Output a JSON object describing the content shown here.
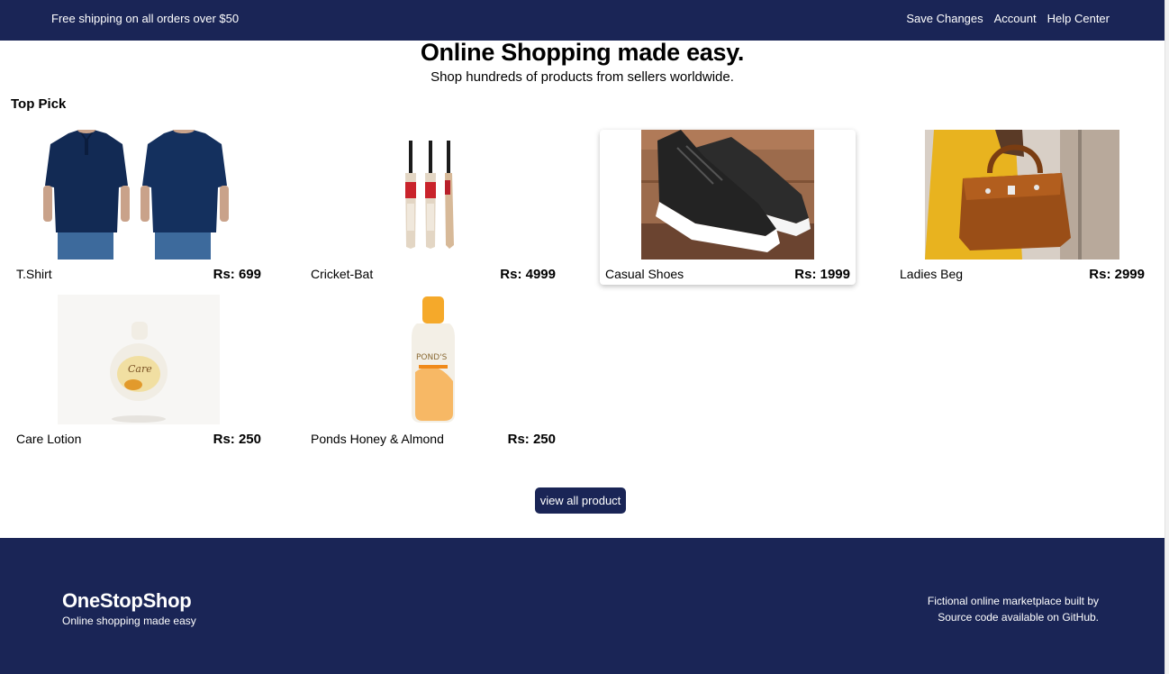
{
  "topbar": {
    "promo": "Free shipping on all orders over $50",
    "links": [
      "Save Changes",
      "Account",
      "Help Center"
    ]
  },
  "hero": {
    "title": "Online Shopping made easy.",
    "subtitle": "Shop hundreds of products from sellers worldwide."
  },
  "section_title": "Top Pick",
  "products": [
    {
      "name": "T.Shirt",
      "price": "Rs: 699"
    },
    {
      "name": "Cricket-Bat",
      "price": "Rs: 4999"
    },
    {
      "name": "Casual Shoes",
      "price": "Rs: 1999"
    },
    {
      "name": "Ladies Beg",
      "price": "Rs: 2999"
    },
    {
      "name": "Care Lotion",
      "price": "Rs: 250"
    },
    {
      "name": "Ponds Honey & Almond",
      "price": "Rs: 250"
    }
  ],
  "view_all_label": "view all product",
  "footer": {
    "brand": "OneStopShop",
    "tagline": "Online shopping made easy",
    "line1": "Fictional online marketplace built by",
    "line2_prefix": "Source code available on ",
    "line2_link": "GitHub."
  },
  "colors": {
    "navy": "#1a2556"
  }
}
